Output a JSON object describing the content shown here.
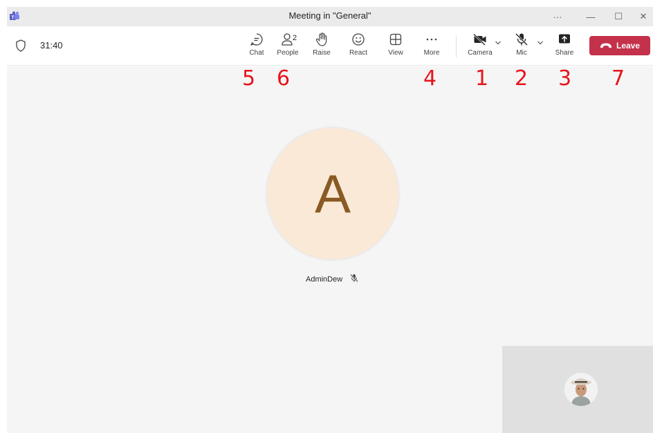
{
  "window": {
    "title": "Meeting in \"General\"",
    "more": "···",
    "minimize": "—",
    "maximize": "☐",
    "close": "✕"
  },
  "toolbar": {
    "timer": "31:40",
    "chat_label": "Chat",
    "people_label": "People",
    "people_count": "2",
    "raise_label": "Raise",
    "react_label": "React",
    "view_label": "View",
    "more_label": "More",
    "camera_label": "Camera",
    "mic_label": "Mic",
    "share_label": "Share",
    "leave_label": "Leave"
  },
  "annotations": {
    "chat": "5",
    "people": "6",
    "more": "4",
    "camera": "1",
    "mic": "2",
    "share": "3",
    "leave": "7"
  },
  "stage": {
    "avatar_initial": "A",
    "participant_name": "AdminDew"
  },
  "colors": {
    "leave_red": "#c4314b",
    "annotation_red": "#e8131a",
    "avatar_bg": "#fbe9d8",
    "avatar_letter": "#8a5a24"
  }
}
